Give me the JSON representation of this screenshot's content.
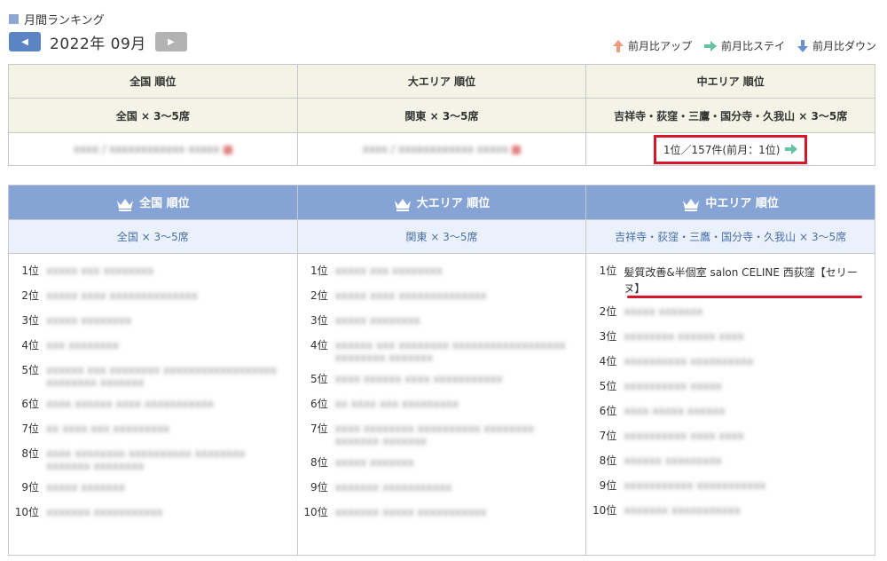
{
  "header": {
    "title": "月間ランキング"
  },
  "month": {
    "label": "2022年 09月",
    "prev_icon": "triangle-left-icon",
    "next_icon": "triangle-right-icon"
  },
  "legend": {
    "up": "前月比アップ",
    "stay": "前月比ステイ",
    "down": "前月比ダウン",
    "colors": {
      "up": "#ee9a80",
      "stay": "#66c2a5",
      "down": "#6a8fd0"
    }
  },
  "summary": {
    "headers": [
      "全国 順位",
      "大エリア 順位",
      "中エリア 順位"
    ],
    "subheaders": [
      "全国 × 3〜5席",
      "関東 × 3〜5席",
      "吉祥寺・荻窪・三鷹・国分寺・久我山 × 3〜5席"
    ],
    "values": [
      "xxxx / xxxxxxxxxxxx xxxxx",
      "xxxx / xxxxxxxxxxxx xxxxx",
      "1位／157件(前月：1位)"
    ]
  },
  "rankings": {
    "headers": [
      "全国 順位",
      "大エリア 順位",
      "中エリア 順位"
    ],
    "subheaders": [
      "全国 × 3〜5席",
      "関東 × 3〜5席",
      "吉祥寺・荻窪・三鷹・国分寺・久我山 × 3〜5席"
    ],
    "columns": [
      [
        {
          "rank": "1位",
          "name": "xxxxx xxx xxxxxxxx"
        },
        {
          "rank": "2位",
          "name": "xxxxx xxxx xxxxxxxxxxxxxx"
        },
        {
          "rank": "3位",
          "name": "xxxxx xxxxxxxx"
        },
        {
          "rank": "4位",
          "name": "xxx xxxxxxxx"
        },
        {
          "rank": "5位",
          "name": "xxxxxx xxx xxxxxxxx xxxxxxxxxxxxxxxxxx xxxxxxxx xxxxxxx"
        },
        {
          "rank": "6位",
          "name": "xxxx xxxxxx xxxx xxxxxxxxxxx"
        },
        {
          "rank": "7位",
          "name": "xx xxxx xxx xxxxxxxxx"
        },
        {
          "rank": "8位",
          "name": "xxxx xxxxxxxx xxxxxxxxxx xxxxxxxx xxxxxxx xxxxxxxx"
        },
        {
          "rank": "9位",
          "name": "xxxxx xxxxxxx"
        },
        {
          "rank": "10位",
          "name": "xxxxxxx xxxxxxxxxxx"
        }
      ],
      [
        {
          "rank": "1位",
          "name": "xxxxx xxx xxxxxxxx"
        },
        {
          "rank": "2位",
          "name": "xxxxx xxxx xxxxxxxxxxxxxx"
        },
        {
          "rank": "3位",
          "name": "xxxxx xxxxxxxx"
        },
        {
          "rank": "4位",
          "name": "xxxxxx xxx xxxxxxxx xxxxxxxxxxxxxxxxxx xxxxxxxx xxxxxxx"
        },
        {
          "rank": "5位",
          "name": "xxxx xxxxxx xxxx xxxxxxxxxxx"
        },
        {
          "rank": "6位",
          "name": "xx xxxx xxx xxxxxxxxx"
        },
        {
          "rank": "7位",
          "name": "xxxx xxxxxxxx xxxxxxxxxx xxxxxxxx xxxxxxx xxxxxxx"
        },
        {
          "rank": "8位",
          "name": "xxxxx xxxxxxx"
        },
        {
          "rank": "9位",
          "name": "xxxxxxx xxxxxxxxxxx"
        },
        {
          "rank": "10位",
          "name": "xxxxxxx xxxxx xxxxxxxxxxx"
        }
      ],
      [
        {
          "rank": "1位",
          "name": "髪質改善&半個室 salon CELINE 西荻窪【セリーヌ】"
        },
        {
          "rank": "2位",
          "name": "xxxxx xxxxxxx"
        },
        {
          "rank": "3位",
          "name": "xxxxxxxx xxxxxx xxxx"
        },
        {
          "rank": "4位",
          "name": "xxxxxxxxxx xxxxxxxxxx"
        },
        {
          "rank": "5位",
          "name": "xxxxxxxxxx xxxxx"
        },
        {
          "rank": "6位",
          "name": "xxxx xxxxx xxxxxx"
        },
        {
          "rank": "7位",
          "name": "xxxxxxxxxx xxxx xxxx"
        },
        {
          "rank": "8位",
          "name": "xxxxxx xxxxxxxxx"
        },
        {
          "rank": "9位",
          "name": "xxxxxxxxxxx xxxxxxxxxxx"
        },
        {
          "rank": "10位",
          "name": "xxxxxxx xxxxxxxxxxx"
        }
      ]
    ]
  }
}
